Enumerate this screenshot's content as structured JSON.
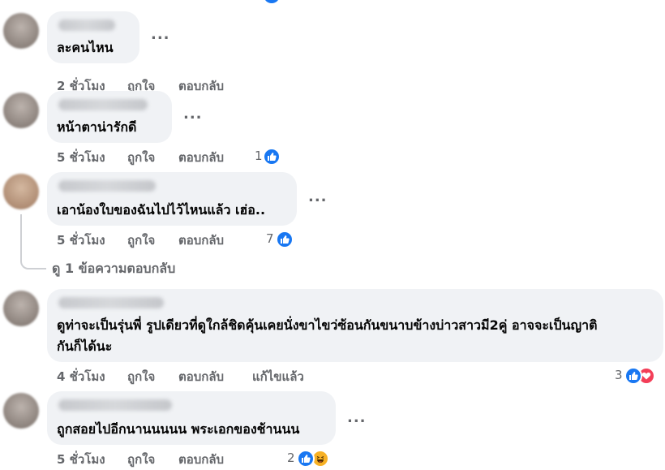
{
  "comments": [
    {
      "text_lines": [
        "ละคนไหน"
      ],
      "time": "2 ชั่วโมง",
      "like": "ถูกใจ",
      "reply": "ตอบกลับ",
      "more": "..."
    },
    {
      "text_lines": [
        "หน้าตาน่ารักดี"
      ],
      "time": "5 ชั่วโมง",
      "like": "ถูกใจ",
      "reply": "ตอบกลับ",
      "more": "...",
      "reaction_count": "1",
      "reactions": [
        "like-icon"
      ]
    },
    {
      "text_lines": [
        "เอาน้องใบของฉันไปไว้ไหนแล้ว เฮ่อ.."
      ],
      "time": "5 ชั่วโมง",
      "like": "ถูกใจ",
      "reply": "ตอบกลับ",
      "more": "...",
      "reaction_count": "7",
      "reactions": [
        "like-icon"
      ],
      "replies_link": "ดู 1 ข้อความตอบกลับ"
    },
    {
      "text_lines": [
        "ดูท่าจะเป็นรุ่นพี่ รูปเดียวที่ดูใกล้ชิดคุ้นเคยนั่งขาไขว่ซ้อนกันขนาบข้างบ่าวสาวมี2คู่ อาจจะเป็นญาติ",
        "กันก็ได้นะ"
      ],
      "time": "4 ชั่วโมง",
      "like": "ถูกใจ",
      "reply": "ตอบกลับ",
      "edited": "แก้ไขแล้ว",
      "reaction_count": "3",
      "reactions": [
        "like-icon",
        "love-icon"
      ]
    },
    {
      "text_lines": [
        "ถูกสอยไปอีกนานนนนน พระเอกของช้านนน"
      ],
      "time": "5 ชั่วโมง",
      "like": "ถูกใจ",
      "reply": "ตอบกลับ",
      "more": "...",
      "reaction_count": "2",
      "reactions": [
        "like-icon",
        "haha-icon"
      ]
    }
  ],
  "colors": {
    "bubble": "#f0f2f5",
    "meta_text": "#65676b",
    "like_blue": "#1877f2",
    "love_red": "#f33e58",
    "haha_yellow": "#f7b125"
  }
}
